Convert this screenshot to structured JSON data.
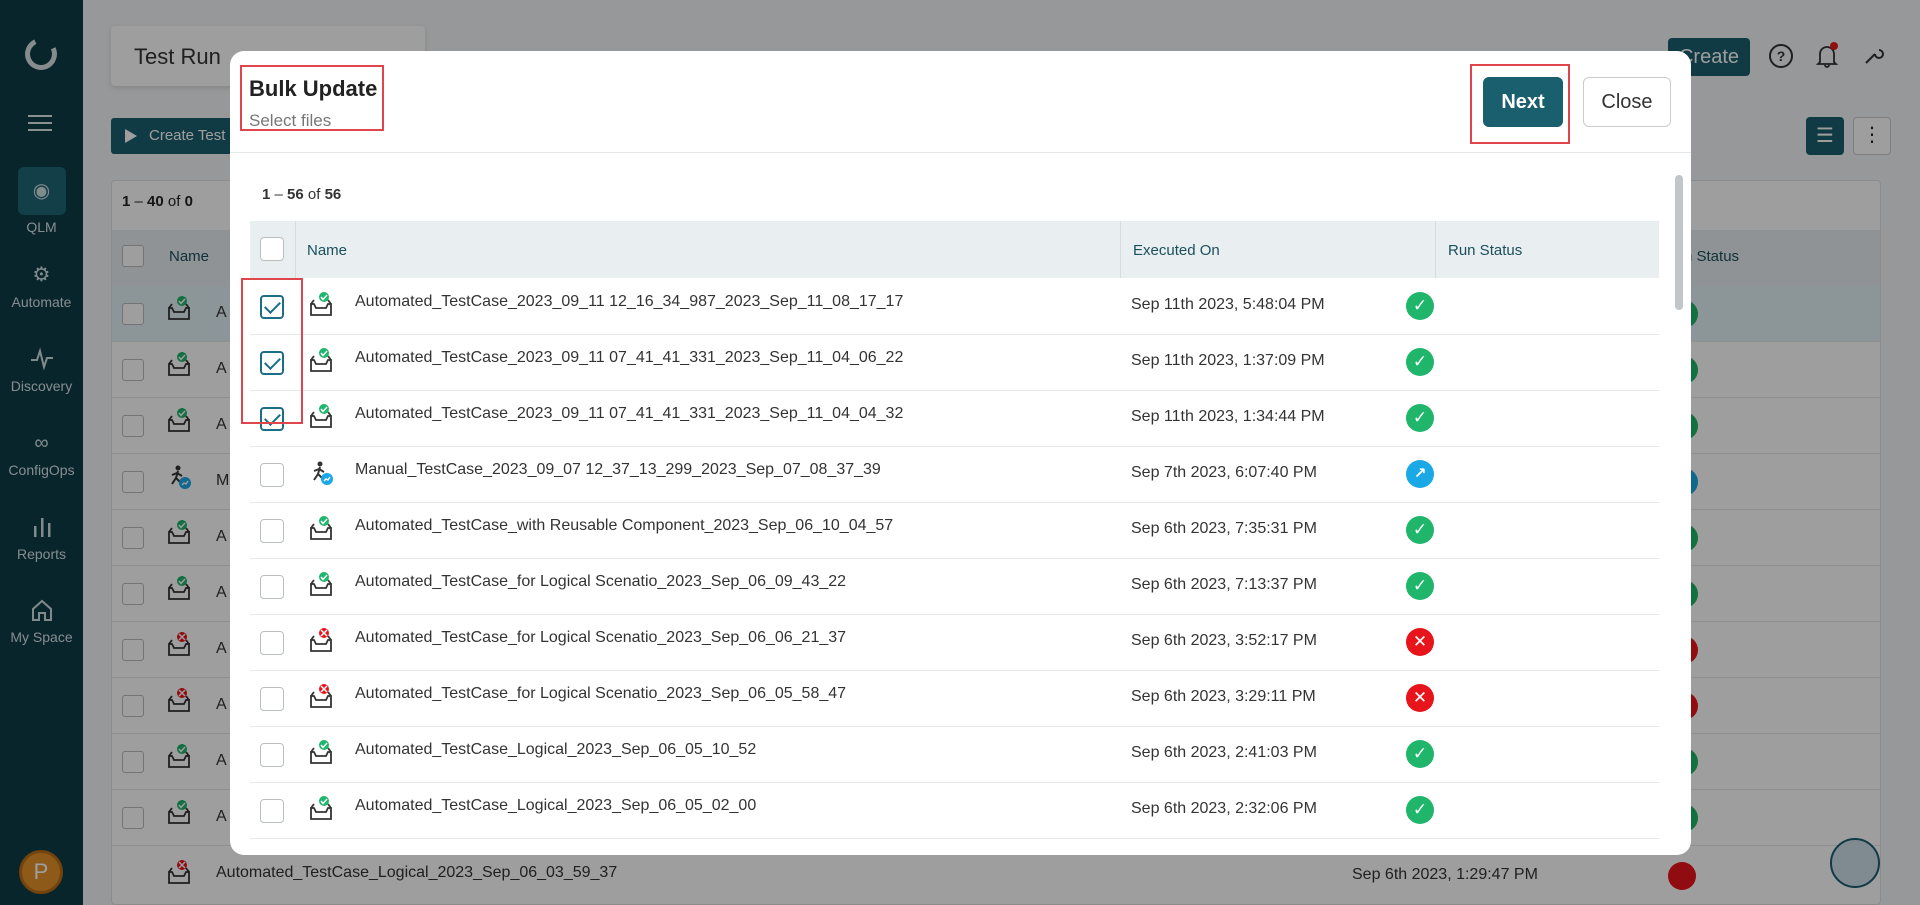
{
  "sidebar": {
    "items": [
      {
        "label": "QLM",
        "icon": "qlm-icon"
      },
      {
        "label": "Automate",
        "icon": "automate-gear-icon"
      },
      {
        "label": "Discovery",
        "icon": "pulse-icon"
      },
      {
        "label": "ConfigOps",
        "icon": "infinity-icon"
      },
      {
        "label": "Reports",
        "icon": "bar-chart-icon"
      },
      {
        "label": "My Space",
        "icon": "home-icon"
      }
    ],
    "avatar_initial": "P"
  },
  "background": {
    "page_title": "Test Run",
    "create_test_run_label": "Create Test",
    "create_label": "Create",
    "count_start": "1",
    "count_end": "40",
    "count_total": "0",
    "header_name": "Name",
    "header_status": "n Status",
    "row_name_fragments": [
      "A",
      "A",
      "A",
      "M",
      "A",
      "A",
      "A",
      "A",
      "A",
      "A"
    ],
    "last_row_name": "Automated_TestCase_Logical_2023_Sep_06_03_59_37",
    "last_row_date": "Sep 6th 2023, 1:29:47 PM"
  },
  "modal": {
    "title": "Bulk Update",
    "subtitle": "Select files",
    "next_label": "Next",
    "close_label": "Close",
    "range_start": "1",
    "range_end": "56",
    "range_total": "56",
    "columns": {
      "name": "Name",
      "executed_on": "Executed On",
      "run_status": "Run Status"
    },
    "rows": [
      {
        "name": "Automated_TestCase_2023_09_11 12_16_34_987_2023_Sep_11_08_17_17",
        "date": "Sep 11th 2023, 5:48:04 PM",
        "status": "passed",
        "type": "automated",
        "checked": true
      },
      {
        "name": "Automated_TestCase_2023_09_11 07_41_41_331_2023_Sep_11_04_06_22",
        "date": "Sep 11th 2023, 1:37:09 PM",
        "status": "passed",
        "type": "automated",
        "checked": true
      },
      {
        "name": "Automated_TestCase_2023_09_11 07_41_41_331_2023_Sep_11_04_04_32",
        "date": "Sep 11th 2023, 1:34:44 PM",
        "status": "passed",
        "type": "automated",
        "checked": true
      },
      {
        "name": "Manual_TestCase_2023_09_07 12_37_13_299_2023_Sep_07_08_37_39",
        "date": "Sep 7th 2023, 6:07:40 PM",
        "status": "in-progress",
        "type": "manual",
        "checked": false
      },
      {
        "name": "Automated_TestCase_with Reusable Component_2023_Sep_06_10_04_57",
        "date": "Sep 6th 2023, 7:35:31 PM",
        "status": "passed",
        "type": "automated",
        "checked": false
      },
      {
        "name": "Automated_TestCase_for Logical Scenatio_2023_Sep_06_09_43_22",
        "date": "Sep 6th 2023, 7:13:37 PM",
        "status": "passed",
        "type": "automated",
        "checked": false
      },
      {
        "name": "Automated_TestCase_for Logical Scenatio_2023_Sep_06_06_21_37",
        "date": "Sep 6th 2023, 3:52:17 PM",
        "status": "failed",
        "type": "automated",
        "checked": false
      },
      {
        "name": "Automated_TestCase_for Logical Scenatio_2023_Sep_06_05_58_47",
        "date": "Sep 6th 2023, 3:29:11 PM",
        "status": "failed",
        "type": "automated",
        "checked": false
      },
      {
        "name": "Automated_TestCase_Logical_2023_Sep_06_05_10_52",
        "date": "Sep 6th 2023, 2:41:03 PM",
        "status": "passed",
        "type": "automated",
        "checked": false
      },
      {
        "name": "Automated_TestCase_Logical_2023_Sep_06_05_02_00",
        "date": "Sep 6th 2023, 2:32:06 PM",
        "status": "passed",
        "type": "automated",
        "checked": false
      }
    ]
  },
  "colors": {
    "sidebar_bg": "#0f3d48",
    "accent": "#1a5f6e",
    "passed": "#1fb56a",
    "failed": "#e8141b",
    "in_progress": "#1aa8e6",
    "highlight": "#e0454c"
  }
}
